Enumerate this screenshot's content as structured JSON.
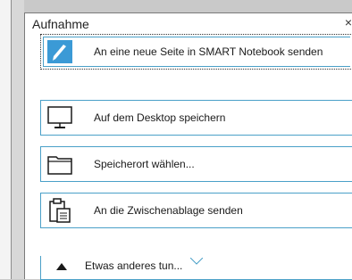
{
  "panel": {
    "title": "Aufnahme",
    "close_glyph": "×"
  },
  "items": [
    {
      "label": "An eine neue Seite in SMART Notebook senden",
      "icon": "smart-notebook-icon"
    },
    {
      "label": "Auf dem Desktop speichern",
      "icon": "monitor-icon"
    },
    {
      "label": "Speicherort wählen...",
      "icon": "folder-icon"
    },
    {
      "label": "An die Zwischenablage senden",
      "icon": "clipboard-icon"
    }
  ],
  "footer": {
    "label": "Etwas anderes tun...",
    "icon": "triangle-up-icon"
  },
  "colors": {
    "accent": "#4aa0c8",
    "notebook_blue": "#3b9ad6"
  }
}
